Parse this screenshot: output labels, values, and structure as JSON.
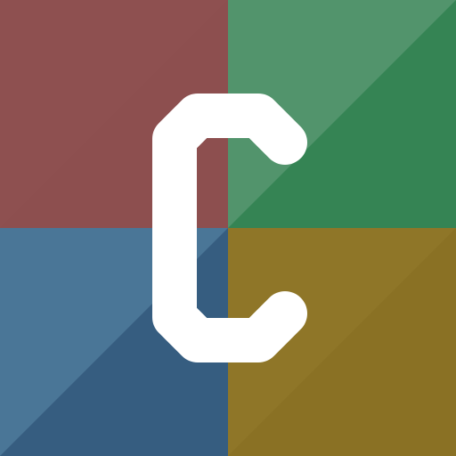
{
  "logo": {
    "icon": "letter-c-logo-icon",
    "letter": "C",
    "colors": {
      "top_left": "#8e5050",
      "top_left_shade": "#8a4c4c",
      "top_right": "#52946c",
      "top_right_shade": "#358454",
      "bottom_left": "#4a7697",
      "bottom_left_shade": "#365d80",
      "bottom_right": "#8f7628",
      "bottom_right_shade": "#8a7124",
      "glyph": "#ffffff"
    }
  }
}
